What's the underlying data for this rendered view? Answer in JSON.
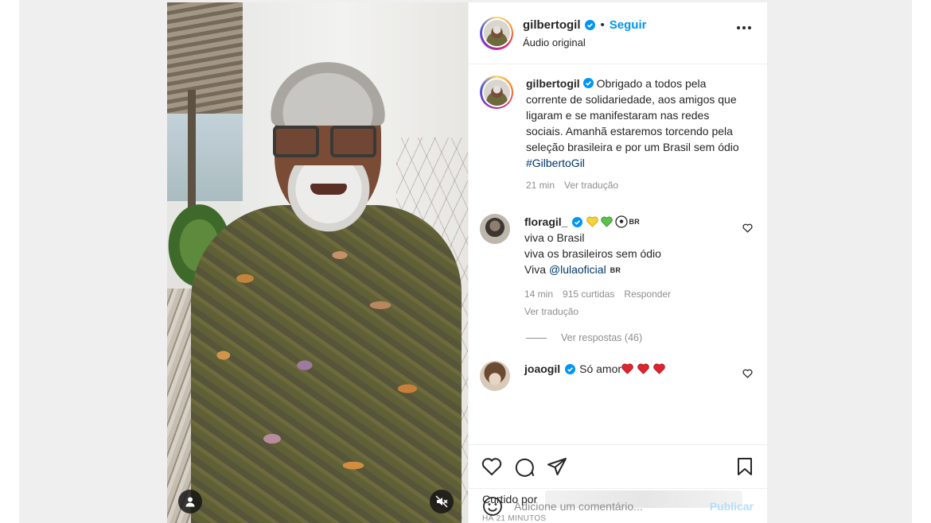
{
  "post": {
    "author": {
      "username": "gilbertogil",
      "separator": "•",
      "follow_label": "Seguir",
      "audio_label": "Áudio original"
    },
    "caption": {
      "username": "gilbertogil",
      "text": "Obrigado a todos pela corrente de solidariedade, aos amigos que ligaram e se manifestaram nas redes sociais. Amanhã estaremos torcendo pela seleção brasileira e por um Brasil sem ódio",
      "hashtag": "#GilbertoGil",
      "time": "21 min",
      "translate": "Ver tradução"
    },
    "comments": [
      {
        "username": "floragil_",
        "flag_code": "BR",
        "line1": "viva o Brasil",
        "line2": "viva os brasileiros sem ódio",
        "line3_prefix": "Viva",
        "mention": "@lulaoficial",
        "mention_flag": "BR",
        "time": "14 min",
        "likes": "915 curtidas",
        "reply": "Responder",
        "translate": "Ver tradução",
        "view_replies": "Ver respostas (46)"
      },
      {
        "username": "joaogil",
        "text": "Só amor"
      }
    ],
    "liked_by_label": "Curtido por",
    "timestamp": "HÁ 21 MINUTOS",
    "add_comment": {
      "placeholder": "Adicione um comentário...",
      "publish_label": "Publicar"
    },
    "colors": {
      "link_blue": "#0095f6",
      "hashtag_blue": "#00376b",
      "muted": "#8e8e8e",
      "publish_disabled": "#b2dffc"
    }
  }
}
